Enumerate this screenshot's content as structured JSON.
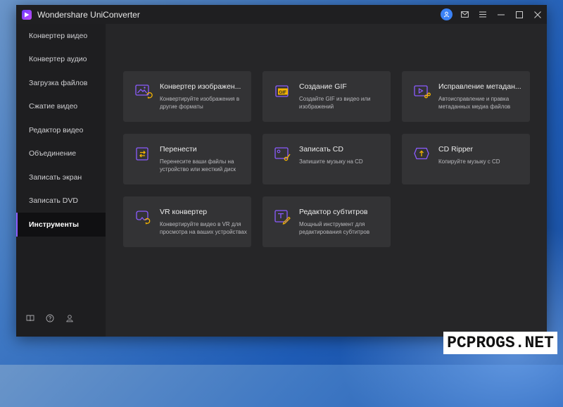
{
  "app": {
    "title": "Wondershare UniConverter",
    "accent_color": "#8c5cff",
    "user_badge_color": "#3b82f6"
  },
  "titlebar_icons": [
    "user-icon",
    "mail-icon",
    "menu-icon",
    "minimize-icon",
    "maximize-icon",
    "close-icon"
  ],
  "sidebar": {
    "items": [
      {
        "label": "Конвертер видео",
        "active": false
      },
      {
        "label": "Конвертер аудио",
        "active": false
      },
      {
        "label": "Загрузка файлов",
        "active": false
      },
      {
        "label": "Сжатие видео",
        "active": false
      },
      {
        "label": "Редактор видео",
        "active": false
      },
      {
        "label": "Объединение",
        "active": false
      },
      {
        "label": "Записать экран",
        "active": false
      },
      {
        "label": "Записать DVD",
        "active": false
      },
      {
        "label": "Инструменты",
        "active": true
      }
    ],
    "bottom_icons": [
      "book-icon",
      "help-icon",
      "account-icon"
    ]
  },
  "tools": [
    {
      "icon": "image-convert-icon",
      "title": "Конвертер изображен...",
      "desc": "Конвертируйте изображения в другие форматы"
    },
    {
      "icon": "gif-icon",
      "title": "Создание GIF",
      "desc": "Создайте GIF из видео или изображений"
    },
    {
      "icon": "metadata-fix-icon",
      "title": "Исправление метадан...",
      "desc": "Автоисправление и правка метаданных медиа файлов"
    },
    {
      "icon": "transfer-icon",
      "title": "Перенести",
      "desc": "Перенесите ваши файлы на устройство или жесткий диск"
    },
    {
      "icon": "burn-cd-icon",
      "title": "Записать CD",
      "desc": "Запишите музыку на CD"
    },
    {
      "icon": "cd-ripper-icon",
      "title": "CD Ripper",
      "desc": "Копируйте музыку с CD"
    },
    {
      "icon": "vr-convert-icon",
      "title": "VR конвертер",
      "desc": "Конвертируйте видео в VR для просмотра на ваших устройствах"
    },
    {
      "icon": "subtitle-editor-icon",
      "title": "Редактор субтитров",
      "desc": "Мощный инструмент для редактирования субтитров"
    }
  ],
  "watermark": {
    "text": "PCPROGS.NET"
  }
}
